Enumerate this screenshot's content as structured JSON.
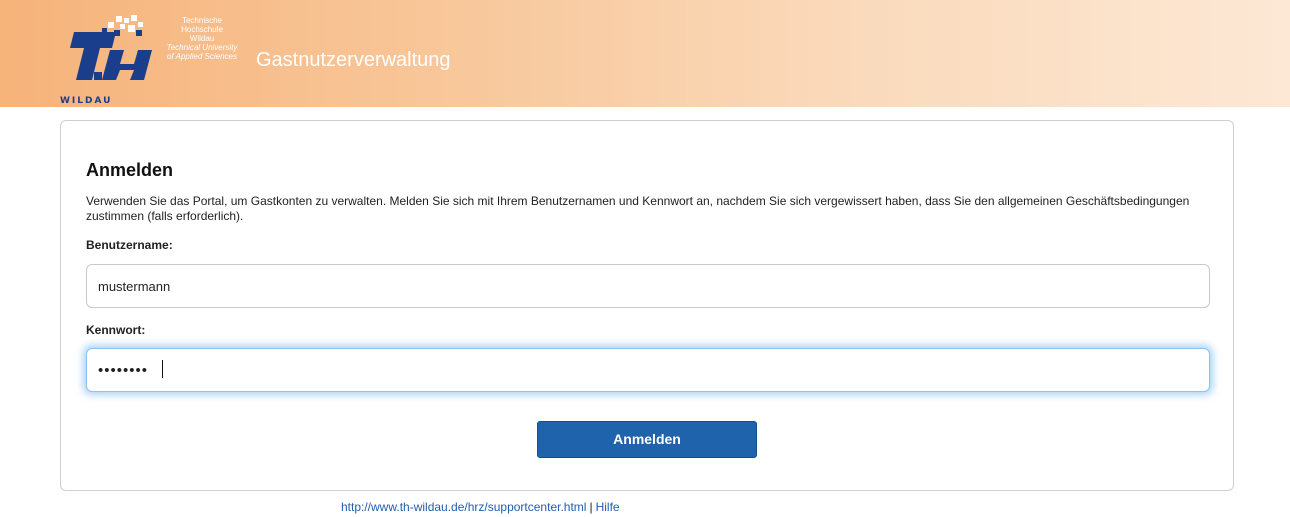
{
  "header": {
    "logo": {
      "line1": "Technische",
      "line2": "Hochschule",
      "line3": "Wildau",
      "line4": "Technical University",
      "line5": "of Applied Sciences",
      "wordmark": "WILDAU",
      "brand_color": "#1b3e8c"
    },
    "app_title": "Gastnutzerverwaltung",
    "gradient_start": "#f6b37a",
    "gradient_end": "#fce8d5"
  },
  "login": {
    "title": "Anmelden",
    "description": "Verwenden Sie das Portal, um Gastkonten zu verwalten. Melden Sie sich mit Ihrem Benutzernamen und Kennwort an, nachdem Sie sich vergewissert haben, dass Sie den allgemeinen Geschäftsbedingungen zustimmen (falls erforderlich).",
    "username_label": "Benutzername:",
    "username_value": "mustermann",
    "password_label": "Kennwort:",
    "password_value": "••••••••",
    "submit_label": "Anmelden",
    "button_color": "#1f63ac"
  },
  "footer": {
    "support_link": "http://www.th-wildau.de/hrz/supportcenter.html",
    "separator": "|",
    "help_link": "Hilfe"
  }
}
